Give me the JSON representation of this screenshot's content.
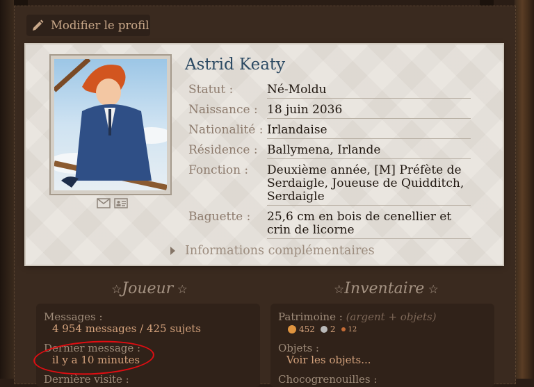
{
  "edit_profile": {
    "label": "Modifier le profil",
    "icon": "pencil-icon"
  },
  "profile": {
    "name": "Astrid Keaty",
    "fields": [
      {
        "label": "Statut :",
        "value": "Né-Moldu"
      },
      {
        "label": "Naissance :",
        "value": "18 juin 2036"
      },
      {
        "label": "Nationalité :",
        "value": "Irlandaise"
      },
      {
        "label": "Résidence :",
        "value": "Ballymena, Irlande"
      },
      {
        "label": "Fonction :",
        "value": "Deuxième année, [M] Préfète de Serdaigle, Joueuse de Quidditch, Serdaigle"
      },
      {
        "label": "Baguette :",
        "value": "25,6 cm en bois de cenellier et crin de licorne"
      }
    ],
    "contact_icons": [
      "envelope-icon",
      "contact-card-icon"
    ],
    "more_info": "Informations complémentaires"
  },
  "joueur": {
    "title": "Joueur",
    "messages_label": "Messages :",
    "messages_value": "4 954 messages / 425 sujets",
    "last_message_label": "Dernier message :",
    "last_message_value": "il y a 10 minutes",
    "last_visit_label": "Dernière visite :"
  },
  "inventaire": {
    "title": "Inventaire",
    "patrimoine_label": "Patrimoine :",
    "patrimoine_hint": "(argent + objets)",
    "gold": "452",
    "silver": "2",
    "bronze": "12",
    "objets_label": "Objets :",
    "objets_link": "Voir les objets...",
    "chocogrenouilles_label": "Chocogrenouilles :"
  },
  "colors": {
    "accent_value": "#d4a27c",
    "label": "#9f8c7a",
    "name": "#2c4a63",
    "annotation": "#e10d12",
    "gold": "#e0943f",
    "silver": "#b9b9b9",
    "bronze": "#c46b35"
  }
}
